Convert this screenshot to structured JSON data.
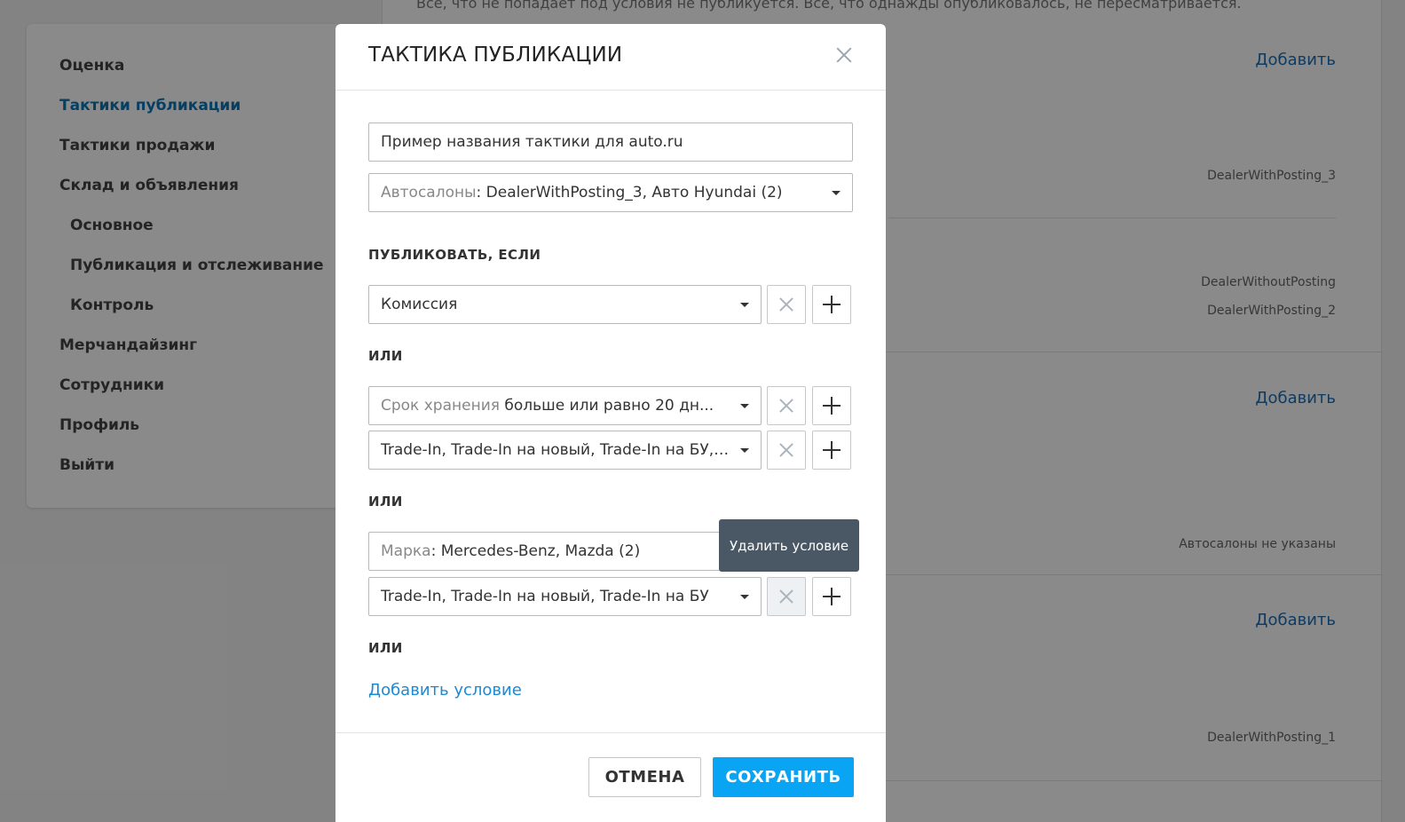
{
  "background": {
    "top_note": "Все, что не попадает под условия не публикуется. Все, что однажды опубликовалось, не пересматривается.",
    "sidebar": [
      {
        "label": "Оценка"
      },
      {
        "label": "Тактики публикации"
      },
      {
        "label": "Тактики продажи"
      },
      {
        "label": "Склад и объявления"
      },
      {
        "label": "Основное"
      },
      {
        "label": "Публикация и отслеживание"
      },
      {
        "label": "Контроль"
      },
      {
        "label": "Мерчандайзинг"
      },
      {
        "label": "Сотрудники"
      },
      {
        "label": "Профиль"
      },
      {
        "label": "Выйти"
      }
    ],
    "add_label": "Добавить",
    "dealers": {
      "d1": "DealerWithPosting_3",
      "d2": "DealerWithoutPosting",
      "d3": "DealerWithPosting_2",
      "d4": "Автосалоны не указаны",
      "d5": "DealerWithPosting_1"
    }
  },
  "modal": {
    "title": "ТАКТИКА ПУБЛИКАЦИИ",
    "name_value": "Пример названия тактики для auto.ru",
    "dealers_field": {
      "label": "Автосалоны",
      "value": ": DealerWithPosting_3, Авто Hyundai (2)"
    },
    "publish_if_label": "ПУБЛИКОВАТЬ, ЕСЛИ",
    "or_label": "ИЛИ",
    "conditions": {
      "c1": {
        "value": "Комиссия"
      },
      "c2": {
        "label": "Срок хранения",
        "value": " больше или равно 20 дн..."
      },
      "c3": {
        "value": "Trade-In, Trade-In на новый, Trade-In на БУ, Вы..."
      },
      "c4": {
        "label": "Марка",
        "value": ": Mercedes-Benz, Mazda (2)"
      },
      "c5": {
        "value": "Trade-In, Trade-In на новый, Trade-In на БУ"
      }
    },
    "tooltip": "Удалить условие",
    "add_condition": "Добавить условие",
    "cancel_label": "ОТМЕНА",
    "save_label": "СОХРАНИТЬ"
  }
}
